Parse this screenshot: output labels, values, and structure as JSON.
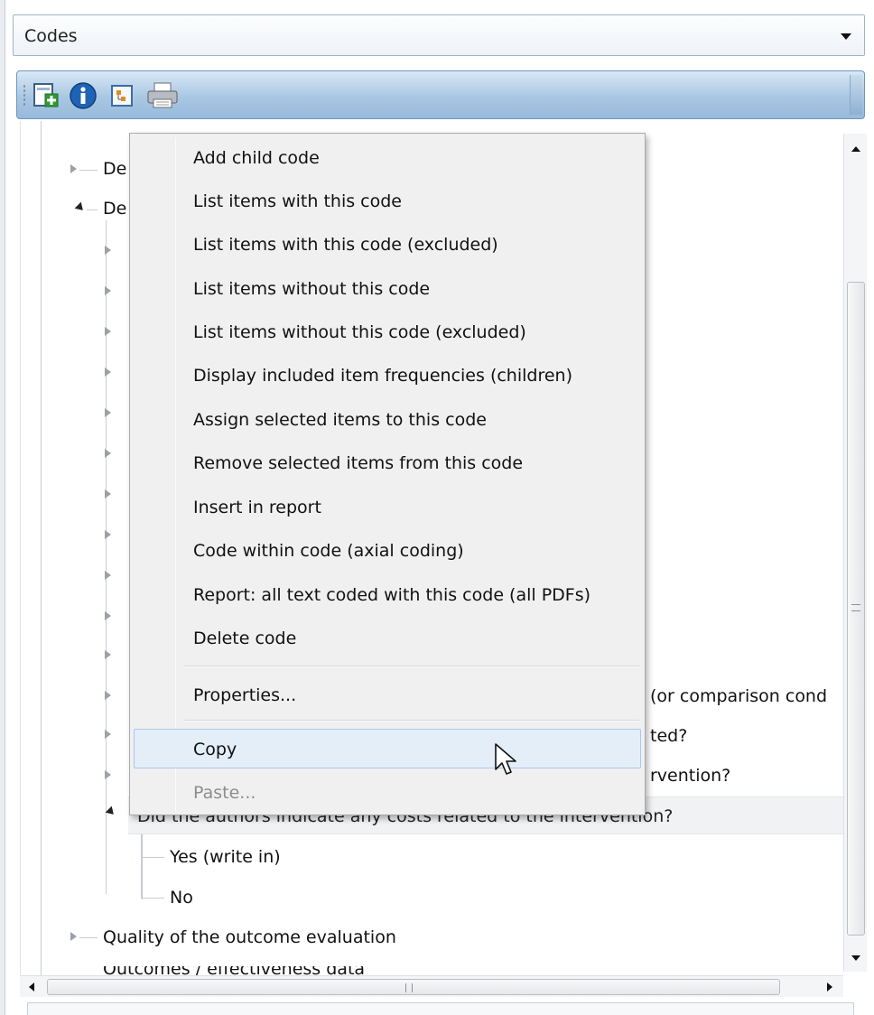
{
  "panel": {
    "title": "Codes"
  },
  "toolbar": {
    "buttons": [
      {
        "icon": "add-code-icon"
      },
      {
        "icon": "info-icon"
      },
      {
        "icon": "code-tree-icon"
      },
      {
        "icon": "print-icon"
      }
    ]
  },
  "tree": {
    "nodes": {
      "de1": "De",
      "de2": "De",
      "frag_comparison": "(or comparison cond",
      "frag_ted": "ted?",
      "frag_intervention": "rvention?",
      "costs_question": "Did the authors indicate any costs related to the intervention?",
      "yes_write_in": "Yes (write in)",
      "no": "No",
      "quality_outcome": "Quality of the outcome evaluation",
      "outcomes_partial": "Outcomes / effectiveness data"
    }
  },
  "context_menu": {
    "items": [
      "Add child code",
      "List items with this code",
      "List items with this code (excluded)",
      "List items without this code",
      "List items without this code (excluded)",
      "Display included item frequencies (children)",
      "Assign selected items to this code",
      "Remove selected items from this code",
      "Insert in report",
      "Code within code (axial coding)",
      "Report: all text coded with this code (all PDFs)",
      "Delete code"
    ],
    "properties": "Properties...",
    "copy": "Copy",
    "paste": "Paste..."
  },
  "colors": {
    "toolbar": "#a9c7e3",
    "menu_bg": "#f0f0f0",
    "hover": "#e3eef9"
  }
}
